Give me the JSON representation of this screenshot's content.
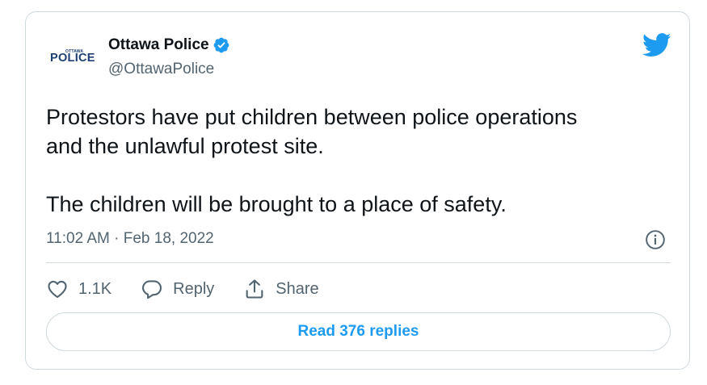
{
  "author": {
    "name": "Ottawa Police",
    "handle": "@OttawaPolice",
    "verified": true,
    "avatar_logo": {
      "top_text": "OTTAWA",
      "main_text": "POLICE"
    }
  },
  "tweet": {
    "text": "Protestors have put children between police operations\nand the unlawful protest site.\n\nThe children will be brought to a place of safety.",
    "timestamp": "11:02 AM · Feb 18, 2022"
  },
  "actions": {
    "like_count": "1.1K",
    "reply_label": "Reply",
    "share_label": "Share"
  },
  "read_replies_label": "Read 376 replies",
  "icons": {
    "verified": "verified-badge-icon",
    "brand": "twitter-bird-icon",
    "info": "info-icon",
    "like": "heart-icon",
    "reply": "reply-bubble-icon",
    "share": "share-icon"
  },
  "colors": {
    "accent": "#1d9bf0",
    "text_primary": "#0f1419",
    "text_secondary": "#536471",
    "border": "#cfd9de",
    "logo_blue": "#1d3f75"
  }
}
